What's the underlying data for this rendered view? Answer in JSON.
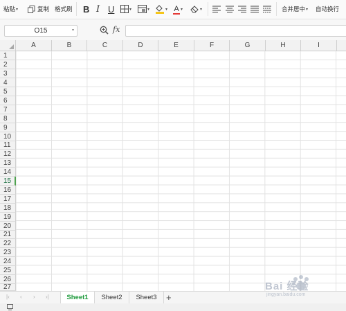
{
  "toolbar": {
    "paste": "粘贴",
    "copy": "复制",
    "format_painter": "格式刷",
    "bold": "B",
    "italic": "I",
    "underline": "U",
    "merge_center": "合并居中",
    "wrap_text": "自动换行",
    "font_color_letter": "A",
    "accent_red": "#e53935",
    "accent_yellow": "#f5c518"
  },
  "formula_bar": {
    "name_box": "O15",
    "fx_label": "fx",
    "formula": ""
  },
  "grid": {
    "columns": [
      "A",
      "B",
      "C",
      "D",
      "E",
      "F",
      "G",
      "H",
      "I"
    ],
    "rows": [
      "1",
      "2",
      "3",
      "4",
      "5",
      "6",
      "7",
      "8",
      "9",
      "10",
      "11",
      "12",
      "13",
      "14",
      "15",
      "16",
      "17",
      "18",
      "19",
      "20",
      "21",
      "22",
      "23",
      "24",
      "25",
      "26",
      "27"
    ],
    "active_row": "15",
    "active_color": "#4ea24e"
  },
  "sheets": {
    "tabs": [
      "Sheet1",
      "Sheet2",
      "Sheet3"
    ],
    "active": "Sheet1",
    "add_label": "+"
  },
  "watermark": {
    "text": "Bai 经验",
    "sub": "jingyan.baidu.com"
  }
}
